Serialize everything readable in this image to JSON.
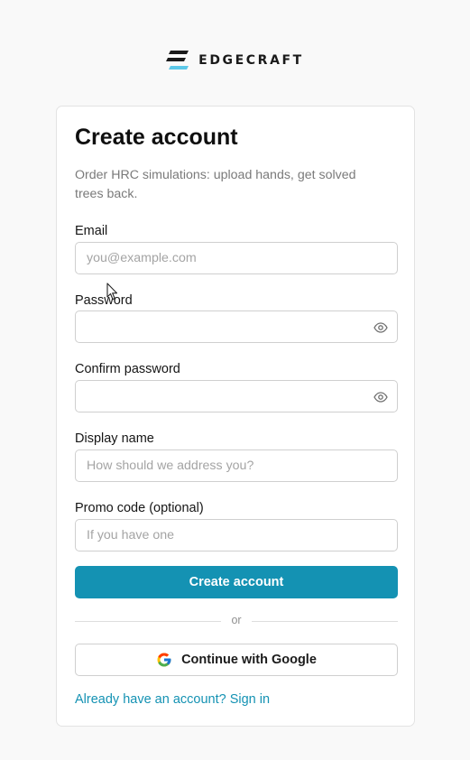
{
  "brand": {
    "name": "EDGECRAFT",
    "logo_icon": "edgecraft-logo-icon",
    "colors": {
      "dark": "#1a1a1a",
      "accent": "#5cc8e8"
    }
  },
  "form": {
    "title": "Create account",
    "subtitle": "Order HRC simulations: upload hands, get solved trees back.",
    "fields": {
      "email": {
        "label": "Email",
        "placeholder": "you@example.com",
        "value": ""
      },
      "password": {
        "label": "Password",
        "placeholder": "",
        "value": "",
        "toggle_icon": "eye-icon"
      },
      "confirm_password": {
        "label": "Confirm password",
        "placeholder": "",
        "value": "",
        "toggle_icon": "eye-icon"
      },
      "display_name": {
        "label": "Display name",
        "placeholder": "How should we address you?",
        "value": ""
      },
      "promo_code": {
        "label": "Promo code (optional)",
        "placeholder": "If you have one",
        "value": ""
      }
    },
    "submit_label": "Create account",
    "divider_text": "or",
    "google_label": "Continue with Google",
    "google_icon": "google-logo-icon",
    "signin_link": "Already have an account? Sign in"
  },
  "colors": {
    "primary": "#1492b3",
    "page_background": "#f9f9f9",
    "card_background": "#ffffff",
    "border": "#cfcfcf",
    "muted_text": "#7a7a7a"
  }
}
